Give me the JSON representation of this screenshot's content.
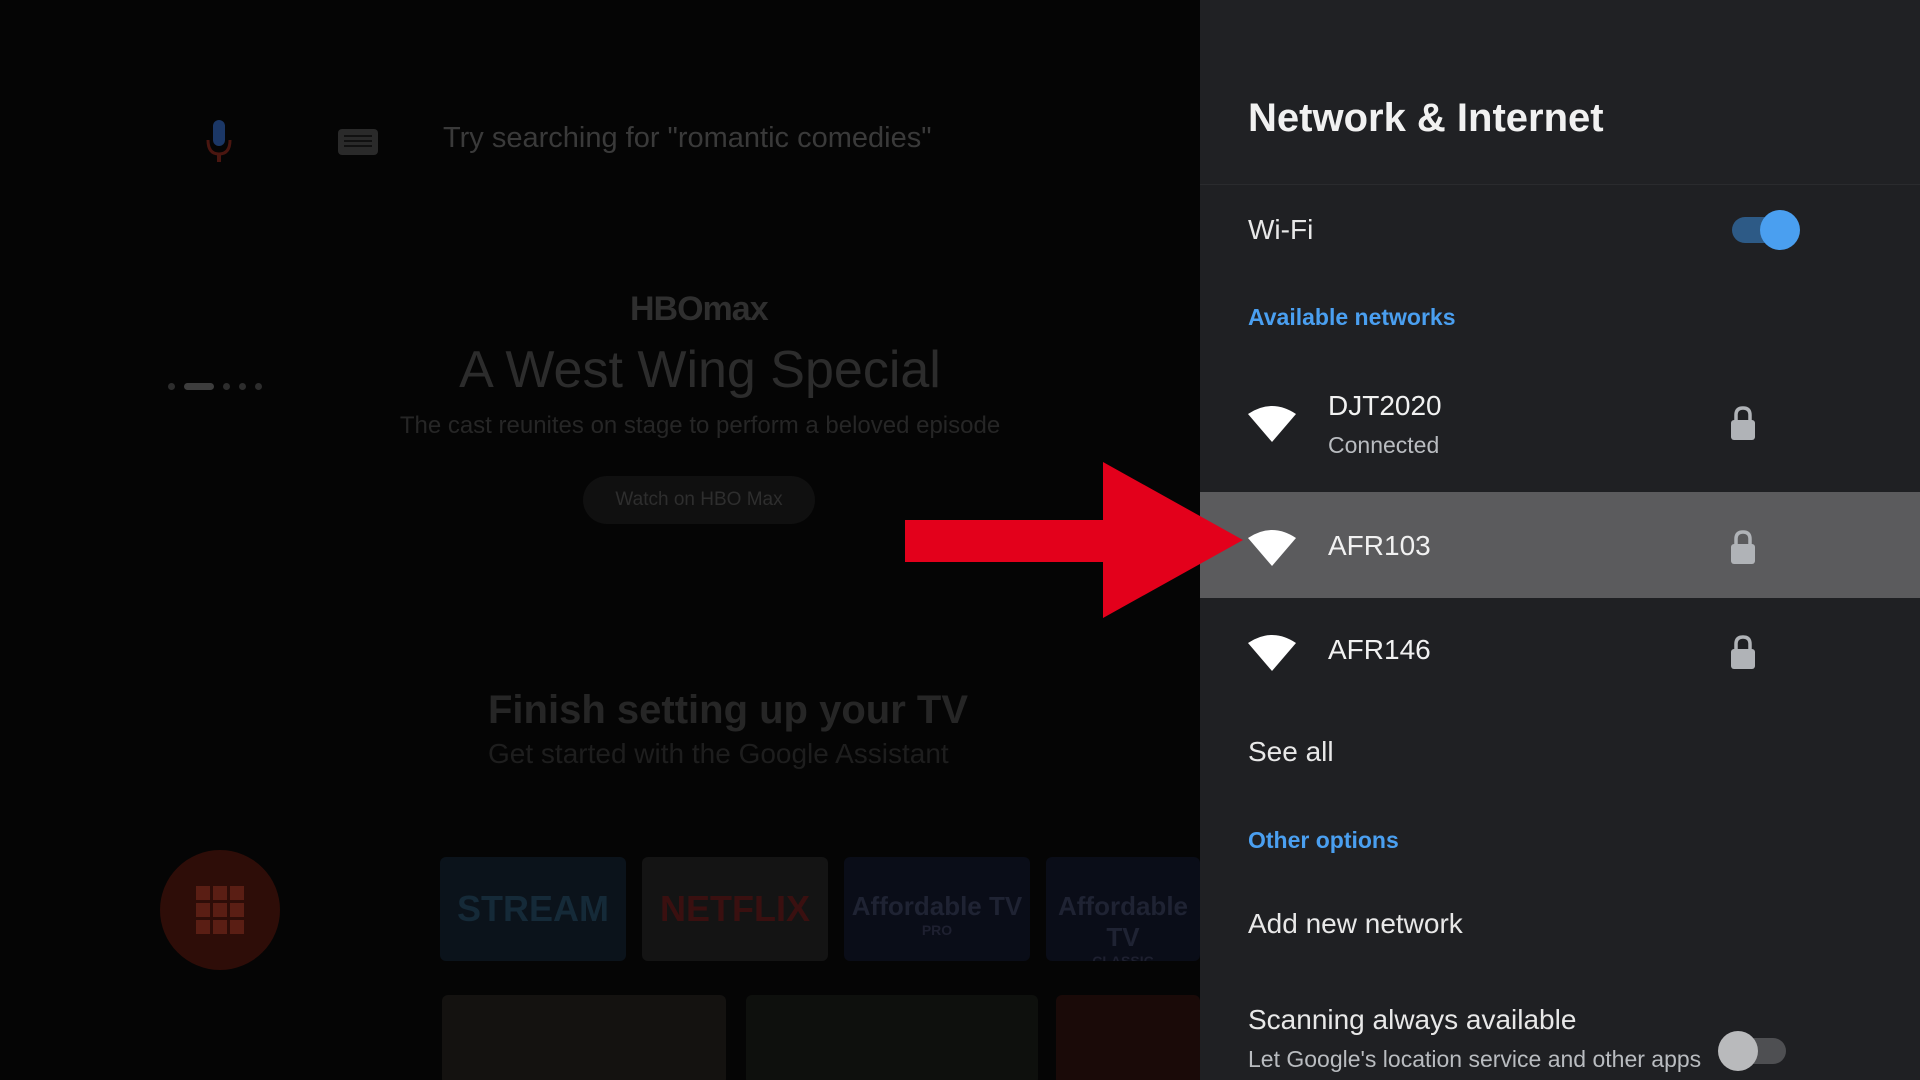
{
  "home": {
    "search_hint": "Try searching for \"romantic comedies\"",
    "hero": {
      "brand": "HBOmax",
      "title": "A West Wing Special",
      "subtitle": "The cast reunites on stage to perform a beloved episode",
      "button_label": "Watch on HBO Max"
    },
    "setup": {
      "title": "Finish setting up your TV",
      "subtitle": "Get started with the Google Assistant"
    },
    "app_tiles": [
      {
        "name": "STREAM",
        "tag": ""
      },
      {
        "name": "NETFLIX",
        "tag": ""
      },
      {
        "name": "Affordable TV",
        "tag": "PRO"
      },
      {
        "name": "Affordable TV",
        "tag": "CLASSIC"
      }
    ]
  },
  "panel": {
    "title": "Network & Internet",
    "wifi": {
      "label": "Wi-Fi",
      "enabled": true
    },
    "available_header": "Available networks",
    "networks": [
      {
        "name": "DJT2020",
        "status": "Connected",
        "secured": true
      },
      {
        "name": "AFR103",
        "status": "",
        "secured": true,
        "focused": true
      },
      {
        "name": "AFR146",
        "status": "",
        "secured": true
      }
    ],
    "see_all": "See all",
    "other_header": "Other options",
    "add_network": "Add new network",
    "scanning": {
      "label": "Scanning always available",
      "description": "Let Google's location service and other apps",
      "enabled": false
    }
  },
  "icons": {
    "mic": "mic-icon",
    "keyboard": "keyboard-icon",
    "wifi": "wifi-icon",
    "lock": "lock-icon",
    "apps": "apps-grid-icon",
    "annotation": "red-arrow"
  },
  "colors": {
    "accent": "#4a9ff0",
    "panel_bg": "#1f2023",
    "highlight_row": "#5b5b5d",
    "toggle_on_knob": "#4a9ff0",
    "toggle_on_track": "#2d5a86",
    "annotation_arrow": "#e3001b"
  }
}
